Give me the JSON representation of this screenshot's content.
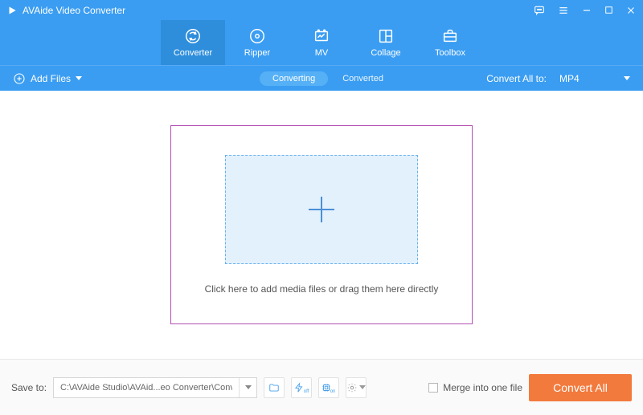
{
  "app": {
    "title": "AVAide Video Converter"
  },
  "nav": {
    "items": [
      {
        "label": "Converter"
      },
      {
        "label": "Ripper"
      },
      {
        "label": "MV"
      },
      {
        "label": "Collage"
      },
      {
        "label": "Toolbox"
      }
    ]
  },
  "subbar": {
    "add_files_label": "Add Files",
    "tab_converting": "Converting",
    "tab_converted": "Converted",
    "convert_all_to_label": "Convert All to:",
    "selected_format": "MP4"
  },
  "main": {
    "drop_text": "Click here to add media files or drag them here directly"
  },
  "footer": {
    "save_to_label": "Save to:",
    "save_path": "C:\\AVAide Studio\\AVAid...eo Converter\\Converted",
    "merge_label": "Merge into one file",
    "convert_all_button": "Convert All"
  }
}
